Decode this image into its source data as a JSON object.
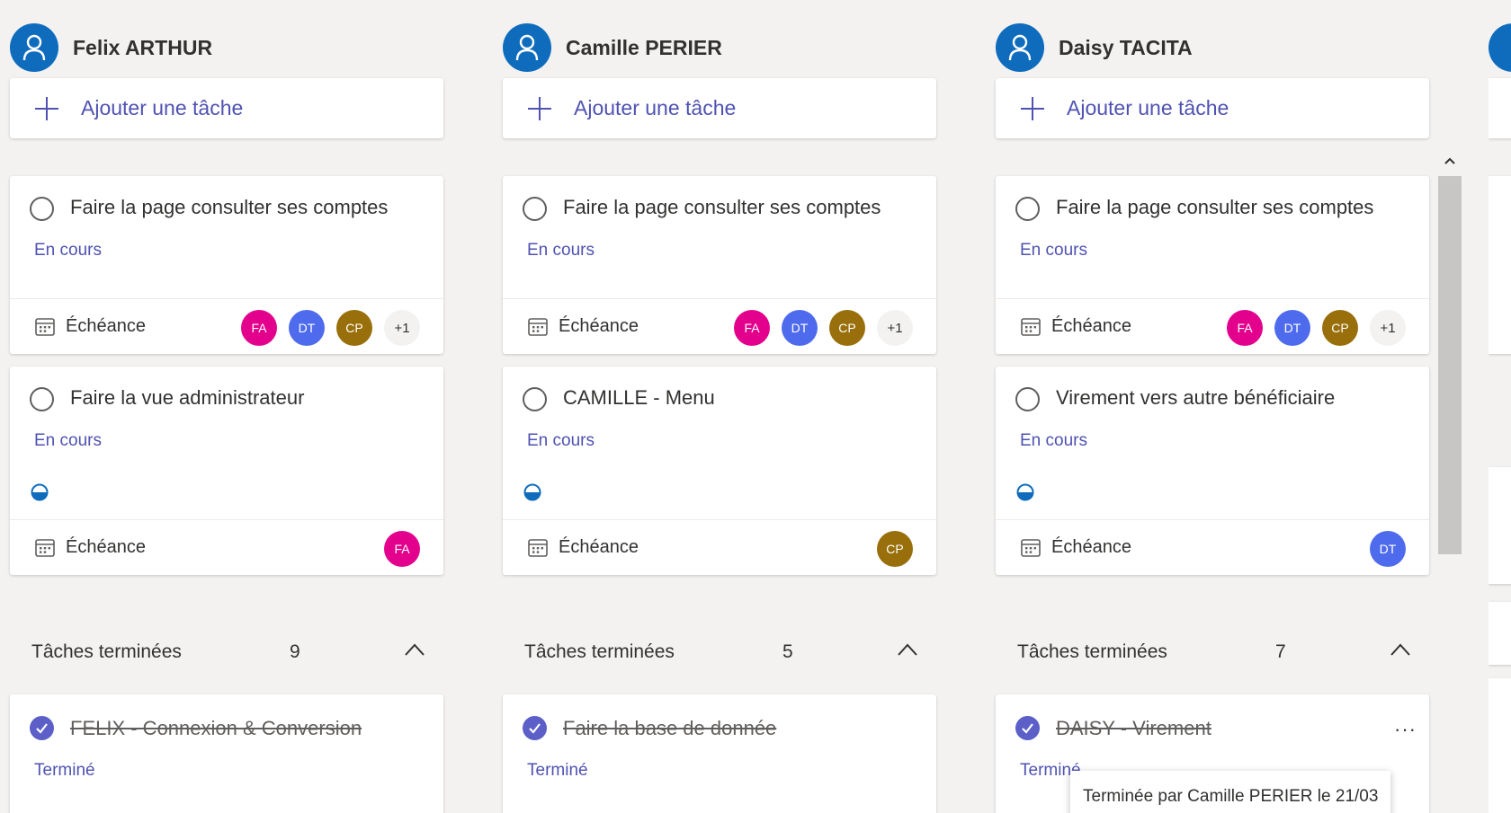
{
  "add_task_label": "Ajouter une tâche",
  "colors": {
    "accent": "#4f52b2",
    "user_avatar": "#0f6cbd",
    "FA": "#e3008c",
    "DT": "#4f6bed",
    "CP": "#986f0b"
  },
  "columns": [
    {
      "name": "Felix ARTHUR",
      "cards": [
        {
          "title": "Faire la page consulter ses comptes",
          "status": "En cours",
          "due": "Échéance",
          "assignees": [
            "FA",
            "DT",
            "CP"
          ],
          "more": "+1",
          "progress": ""
        },
        {
          "title": "Faire la vue administrateur",
          "status": "En cours",
          "due": "Échéance",
          "assignees": [
            "FA"
          ],
          "more": "",
          "progress": "half-circle-icon"
        }
      ],
      "completed": {
        "label": "Tâches terminées",
        "count": "9"
      },
      "done_card": {
        "title": "FELIX - Connexion & Conversion",
        "status": "Terminé"
      }
    },
    {
      "name": "Camille PERIER",
      "cards": [
        {
          "title": "Faire la page consulter ses comptes",
          "status": "En cours",
          "due": "Échéance",
          "assignees": [
            "FA",
            "DT",
            "CP"
          ],
          "more": "+1",
          "progress": ""
        },
        {
          "title": "CAMILLE - Menu",
          "status": "En cours",
          "due": "Échéance",
          "assignees": [
            "CP"
          ],
          "more": "",
          "progress": "half-circle-icon"
        }
      ],
      "completed": {
        "label": "Tâches terminées",
        "count": "5"
      },
      "done_card": {
        "title": "Faire la base de donnée",
        "status": "Terminé"
      }
    },
    {
      "name": "Daisy TACITA",
      "cards": [
        {
          "title": "Faire la page consulter ses comptes",
          "status": "En cours",
          "due": "Échéance",
          "assignees": [
            "FA",
            "DT",
            "CP"
          ],
          "more": "+1",
          "progress": ""
        },
        {
          "title": "Virement vers autre bénéficiaire",
          "status": "En cours",
          "due": "Échéance",
          "assignees": [
            "DT"
          ],
          "more": "",
          "progress": "half-circle-icon"
        }
      ],
      "completed": {
        "label": "Tâches terminées",
        "count": "7"
      },
      "done_card": {
        "title": "DAISY - Virement",
        "status": "Terminé",
        "more_actions": "···"
      }
    }
  ],
  "tooltip": "Terminée par Camille PERIER le 21/03"
}
